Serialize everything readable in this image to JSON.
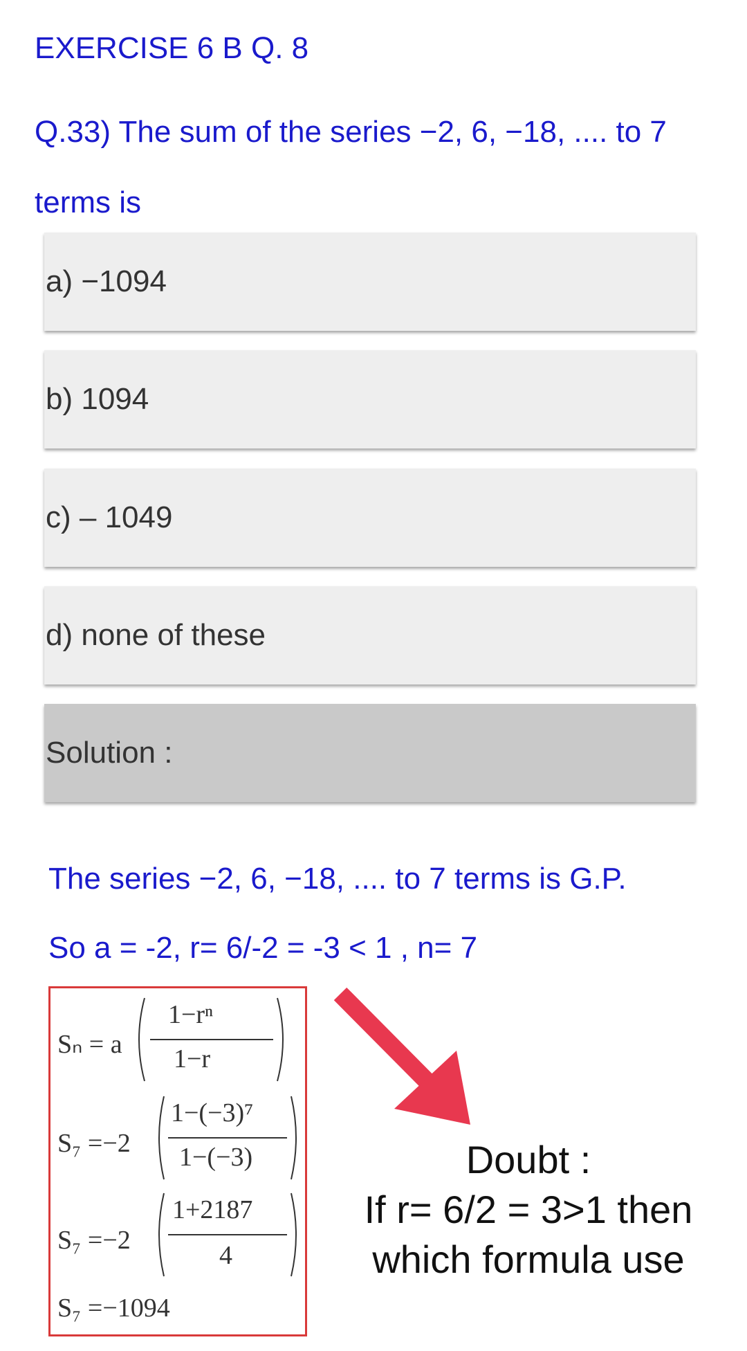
{
  "header": {
    "title": "EXERCISE 6 B Q. 8"
  },
  "question": {
    "text": "Q.33) The sum of the series −2, 6, −18, .... to 7 terms is"
  },
  "options": [
    {
      "label": "a) −1094"
    },
    {
      "label": "b) 1094"
    },
    {
      "label": "c) – 1049"
    },
    {
      "label": "d) none of these"
    }
  ],
  "solution": {
    "label": "Solution :",
    "line1": "The series −2, 6, −18, .... to 7 terms is G.P.",
    "line2": "So a = -2, r= 6/-2 = -3 < 1 , n= 7"
  },
  "formulas": {
    "f1_lhs": "Sₙ = a",
    "f1_num": "1−rⁿ",
    "f1_den": "1−r",
    "f2_lhs": "S₇ =−2",
    "f2_num": "1−(−3)⁷",
    "f2_den": "1−(−3)",
    "f3_lhs": "S₇ =−2",
    "f3_num": "1+2187",
    "f3_den": "4",
    "f4": "S₇ =−1094"
  },
  "doubt": {
    "line1": "Doubt :",
    "line2": "If r= 6/2 = 3>1 then",
    "line3": "which formula use"
  },
  "colors": {
    "text_blue": "#1a1acc",
    "arrow": "#e8384f",
    "box_border": "#d93a3a"
  }
}
